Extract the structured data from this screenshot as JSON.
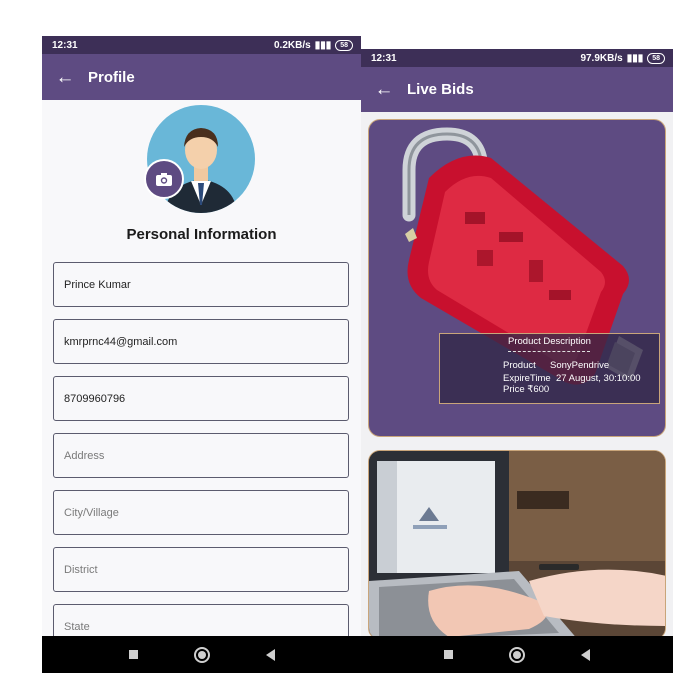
{
  "left_screen": {
    "status": {
      "time": "12:31",
      "net_speed": "0.2KB/s",
      "battery": "58"
    },
    "appbar": {
      "back_icon": "arrow-left-icon",
      "title": "Profile"
    },
    "section_title": "Personal Information",
    "fields": [
      {
        "value": "Prince Kumar",
        "placeholder": ""
      },
      {
        "value": "kmrprnc44@gmail.com",
        "placeholder": ""
      },
      {
        "value": "8709960796",
        "placeholder": ""
      },
      {
        "value": "",
        "placeholder": "Address"
      },
      {
        "value": "",
        "placeholder": "City/Village"
      },
      {
        "value": "",
        "placeholder": "District"
      },
      {
        "value": "",
        "placeholder": "State"
      }
    ]
  },
  "right_screen": {
    "status": {
      "time": "12:31",
      "net_speed": "97.9KB/s",
      "battery": "58"
    },
    "appbar": {
      "back_icon": "arrow-left-icon",
      "title": "Live Bids"
    },
    "bid_card": {
      "description_title": "Product Description",
      "product_label": "Product",
      "product_value": "SonyPendrive",
      "expire_label": "ExpireTime",
      "expire_value": "27 August, 30:10:00",
      "price_text": "Price ₹600"
    }
  },
  "colors": {
    "primary": "#5e4b82",
    "status_bar": "#3d2f57",
    "card_border": "#c9a57a"
  }
}
